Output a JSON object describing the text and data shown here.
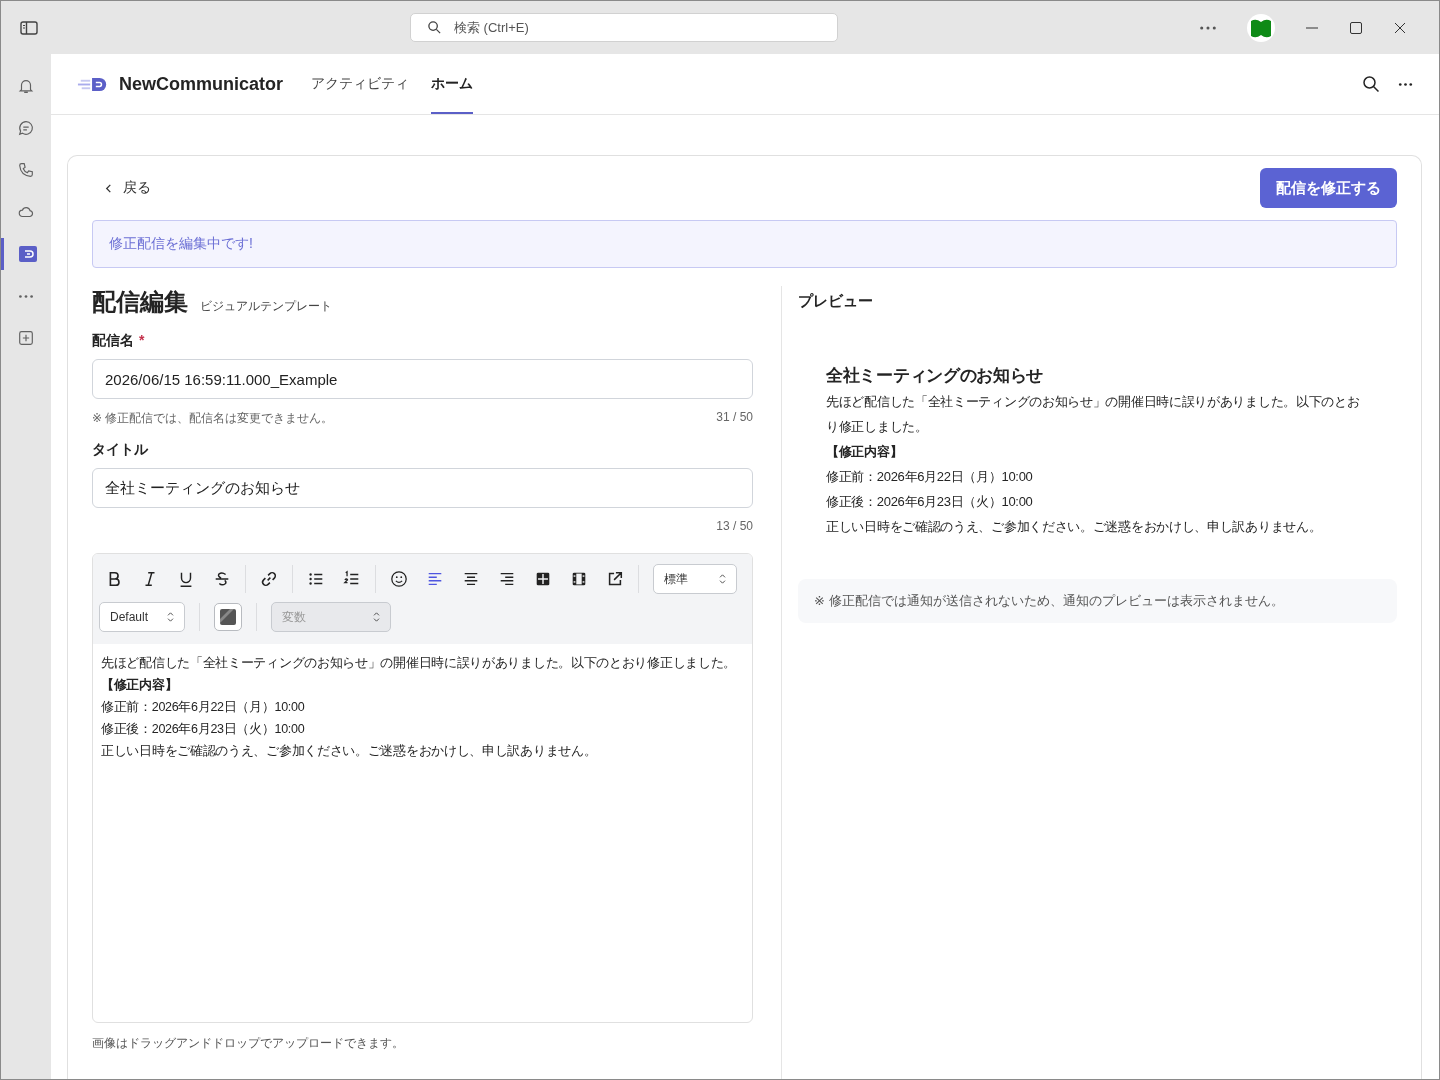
{
  "titlebar": {
    "search_placeholder": "検索 (Ctrl+E)"
  },
  "rail": [
    {
      "kind": "bell",
      "selected": false
    },
    {
      "kind": "chat",
      "selected": false
    },
    {
      "kind": "phone",
      "selected": false
    },
    {
      "kind": "cloud",
      "selected": false
    },
    {
      "kind": "app",
      "selected": true
    },
    {
      "kind": "more",
      "selected": false
    },
    {
      "kind": "add",
      "selected": false
    }
  ],
  "app": {
    "name": "NewCommunicator",
    "tabs": [
      {
        "label": "アクティビティ",
        "selected": false
      },
      {
        "label": "ホーム",
        "selected": true
      }
    ]
  },
  "page": {
    "back": "戻る",
    "submit": "配信を修正する",
    "banner": "修正配信を編集中です!",
    "heading": "配信編集",
    "template": "ビジュアルテンプレート"
  },
  "fields": [
    {
      "label": "配信名",
      "required_mark": "*",
      "value": "2026/06/15 16:59:11.000_Example",
      "hint": "※ 修正配信では、配信名は変更できません。",
      "count": "31 / 50"
    },
    {
      "label": "タイトル",
      "value": "全社ミーティングのお知らせ",
      "count": "13 / 50"
    }
  ],
  "editor": {
    "alignment": [
      {
        "selected": true
      },
      {
        "selected": false
      },
      {
        "selected": false
      }
    ],
    "size_select": "標準",
    "font_select": "Default",
    "variable_select": {
      "placeholder": "変数",
      "disabled": true
    },
    "lines": [
      {
        "text": "先ほど配信した「全社ミーティングのお知らせ」の開催日時に誤りがありました。以下のとおり修正しました。",
        "bold": false
      },
      {
        "text": "【修正内容】",
        "bold": true
      },
      {
        "text": "修正前：2026年6月22日（月）10:00",
        "bold": false
      },
      {
        "text": "修正後：2026年6月23日（火）10:00",
        "bold": false
      },
      {
        "text": "正しい日時をご確認のうえ、ご参加ください。ご迷惑をおかけし、申し訳ありません。",
        "bold": false
      }
    ],
    "note": "画像はドラッグアンドドロップでアップロードできます。"
  },
  "preview": {
    "label": "プレビュー",
    "title": "全社ミーティングのお知らせ",
    "lines": [
      {
        "text": "先ほど配信した「全社ミーティングのお知らせ」の開催日時に誤りがありました。以下のとおり修正しました。",
        "bold": false
      },
      {
        "text": "【修正内容】",
        "bold": true
      },
      {
        "text": "修正前：2026年6月22日（月）10:00",
        "bold": false
      },
      {
        "text": "修正後：2026年6月23日（火）10:00",
        "bold": false
      },
      {
        "text": "正しい日時をご確認のうえ、ご参加ください。ご迷惑をおかけし、申し訳ありません。",
        "bold": false
      }
    ],
    "notice": "※ 修正配信では通知が送信されないため、通知のプレビューは表示されません。"
  }
}
